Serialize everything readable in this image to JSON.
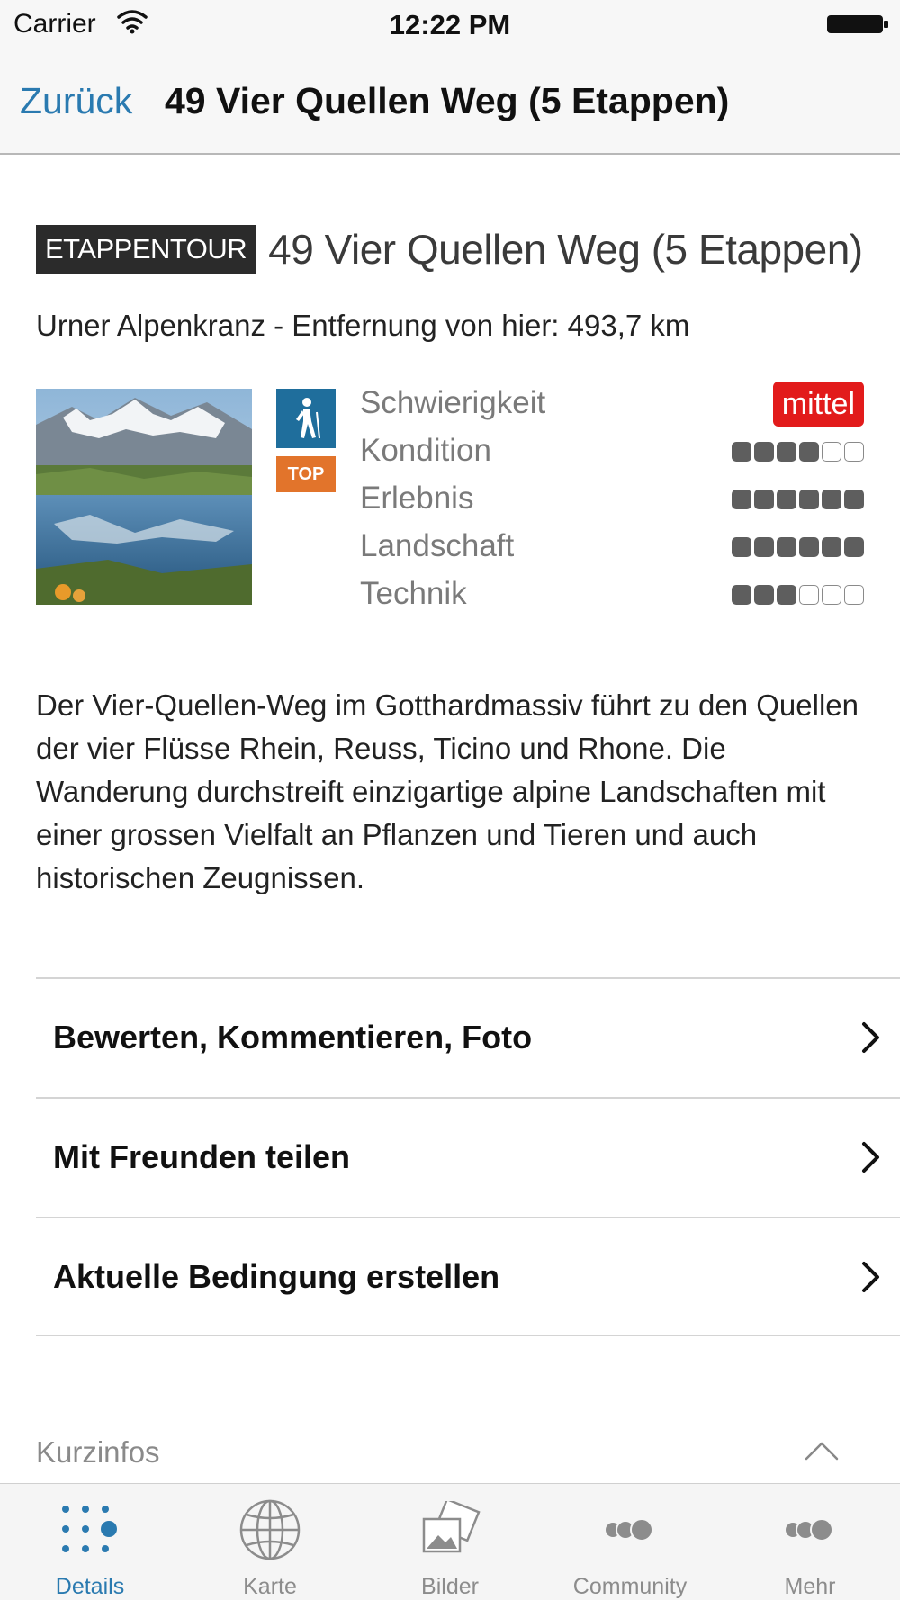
{
  "status_bar": {
    "carrier": "Carrier",
    "time": "12:22 PM"
  },
  "nav": {
    "back_label": "Zurück",
    "title": "49 Vier Quellen Weg (5 Etappen)"
  },
  "tour": {
    "badge": "ETAPPENTOUR",
    "title": "49 Vier Quellen Weg (5 Etappen)",
    "region_line": "Urner Alpenkranz - Entfernung von hier: 493,7 km",
    "type_icon": "hiker-icon",
    "top_badge": "TOP",
    "accent_color": "#1f6e9c",
    "top_color": "#e2742b",
    "difficulty_color": "#e21b1b"
  },
  "ratings": [
    {
      "label": "Schwierigkeit",
      "value_text": "mittel"
    },
    {
      "label": "Kondition",
      "score": 4,
      "max": 6
    },
    {
      "label": "Erlebnis",
      "score": 6,
      "max": 6
    },
    {
      "label": "Landschaft",
      "score": 6,
      "max": 6
    },
    {
      "label": "Technik",
      "score": 3,
      "max": 6
    }
  ],
  "description": "Der Vier-Quellen-Weg im Gotthardmassiv führt zu den Quellen der vier Flüsse Rhein, Reuss, Ticino und Rhone. Die Wanderung durchstreift einzigartige alpine Landschaften mit einer grossen Vielfalt an Pflanzen und Tieren und auch historischen Zeugnissen.",
  "actions": [
    {
      "label": "Bewerten, Kommentieren, Foto"
    },
    {
      "label": "Mit Freunden teilen"
    },
    {
      "label": "Aktuelle Bedingung erstellen"
    }
  ],
  "section": {
    "label": "Kurzinfos"
  },
  "tabs": [
    {
      "label": "Details",
      "icon": "dots-grid-icon",
      "active": true
    },
    {
      "label": "Karte",
      "icon": "globe-icon",
      "active": false
    },
    {
      "label": "Bilder",
      "icon": "photos-icon",
      "active": false
    },
    {
      "label": "Community",
      "icon": "community-icon",
      "active": false
    },
    {
      "label": "Mehr",
      "icon": "more-icon",
      "active": false
    }
  ]
}
